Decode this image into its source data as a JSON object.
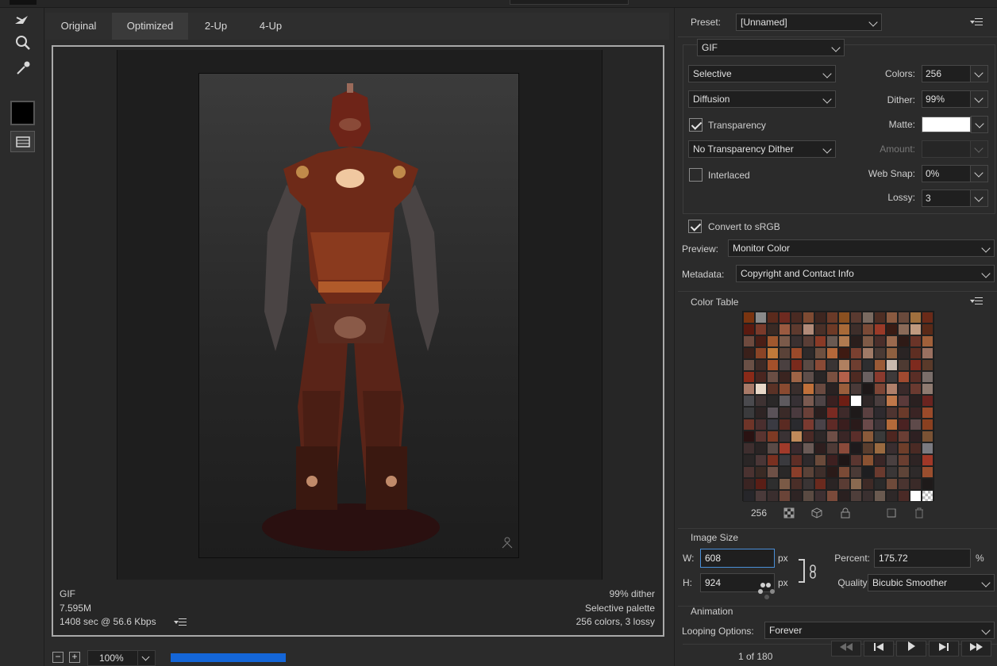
{
  "tabs": [
    {
      "label": "Original"
    },
    {
      "label": "Optimized"
    },
    {
      "label": "2-Up"
    },
    {
      "label": "4-Up"
    }
  ],
  "active_tab": "Optimized",
  "preview_info": {
    "format": "GIF",
    "size": "7.595M",
    "time": "1408 sec @ 56.6 Kbps",
    "dither": "99% dither",
    "palette": "Selective palette",
    "colors_lossy": "256 colors, 3 lossy"
  },
  "zoom": {
    "minus": "−",
    "plus": "+",
    "value": "100%"
  },
  "settings": {
    "preset_label": "Preset:",
    "preset_value": "[Unnamed]",
    "format_value": "GIF",
    "reduction_value": "Selective",
    "dither_algo_value": "Diffusion",
    "transparency_label": "Transparency",
    "transparency_checked": true,
    "transparency_dither_value": "No Transparency Dither",
    "interlaced_label": "Interlaced",
    "interlaced_checked": false,
    "colors_label": "Colors:",
    "colors_value": "256",
    "dither_label": "Dither:",
    "dither_value": "99%",
    "matte_label": "Matte:",
    "matte_color": "#ffffff",
    "amount_label": "Amount:",
    "amount_value": "",
    "websnap_label": "Web Snap:",
    "websnap_value": "0%",
    "lossy_label": "Lossy:",
    "lossy_value": "3",
    "convert_srgb_label": "Convert to sRGB",
    "convert_srgb_checked": true,
    "preview_label": "Preview:",
    "preview_value": "Monitor Color",
    "metadata_label": "Metadata:",
    "metadata_value": "Copyright and Contact Info"
  },
  "color_table": {
    "title": "Color Table",
    "count": "256",
    "colors": [
      "#7a3410",
      "#8a8a8a",
      "#5a2a1c",
      "#6e2a20",
      "#4a2a22",
      "#7e4a32",
      "#3e2620",
      "#6a3a28",
      "#8a5020",
      "#5a3a30",
      "#7a6a60",
      "#4e2e24",
      "#8a5a40",
      "#6a4a3c",
      "#a0703e",
      "#6a2a18",
      "#5a1a10",
      "#7a3a2a",
      "#3a2a24",
      "#9a5a40",
      "#5e3a2e",
      "#b08a78",
      "#4a3028",
      "#6e3a26",
      "#a86a38",
      "#3e2e2a",
      "#7a4a36",
      "#9a3a28",
      "#3a1c14",
      "#8a6a58",
      "#c09a80",
      "#5a2a18",
      "#6e4a3e",
      "#4a1e16",
      "#a0582e",
      "#7a5a4a",
      "#3a3030",
      "#5a3e36",
      "#8a3a26",
      "#6a5a52",
      "#b07a50",
      "#2a1e1c",
      "#7e5a46",
      "#4a2e2a",
      "#9a6a4e",
      "#2e1a16",
      "#6a3428",
      "#a0603a",
      "#3a201a",
      "#8a4426",
      "#c07a3a",
      "#5a4238",
      "#9a4a2a",
      "#2e2a2a",
      "#6e5040",
      "#b4683a",
      "#3e1a12",
      "#7a4030",
      "#a07a66",
      "#4a3a34",
      "#8e6040",
      "#2a2424",
      "#5e2e22",
      "#9a7060",
      "#6a5046",
      "#3e2a26",
      "#a4502a",
      "#4a4040",
      "#7a2a1c",
      "#5a4a44",
      "#8a4a36",
      "#3a3434",
      "#b08060",
      "#6e3e30",
      "#2e2e30",
      "#9a5a36",
      "#cabaae",
      "#4e3a32",
      "#7e2a1e",
      "#5a3a2a",
      "#8a2a18",
      "#4a2620",
      "#6a4e44",
      "#3a2420",
      "#9e6446",
      "#5e4e4a",
      "#2a2626",
      "#7a5040",
      "#b4604a",
      "#4e2a22",
      "#6a6060",
      "#8a3a2e",
      "#3e3a3a",
      "#a04a30",
      "#5a2e26",
      "#7a6e6a",
      "#a87a68",
      "#e8d8c8",
      "#5a3226",
      "#8a4a30",
      "#3a2e2c",
      "#c0703a",
      "#6a4a40",
      "#2a2222",
      "#9a5e3c",
      "#4a3a38",
      "#1e1818",
      "#7e4636",
      "#b0806a",
      "#3a2a2a",
      "#6a3a30",
      "#8e7a70",
      "#4a4a4e",
      "#3e3232",
      "#2a2828",
      "#5e5a5e",
      "#363034",
      "#7a5a50",
      "#4e4446",
      "#3a2020",
      "#6e1e14",
      "#ffffff",
      "#2e2626",
      "#4a3e3e",
      "#c0784a",
      "#5a3a3a",
      "#2a2020",
      "#6a2420",
      "#3a3a3c",
      "#2e2424",
      "#5a5258",
      "#3a2a28",
      "#4a3a3e",
      "#6a4038",
      "#2a1e1e",
      "#7a2a22",
      "#3e2a2a",
      "#1e1a1a",
      "#5a4040",
      "#2e2a2e",
      "#4e3430",
      "#6a3a2a",
      "#3a2424",
      "#9a4a2a",
      "#6e3428",
      "#4a2e2e",
      "#3a3a42",
      "#5a2a22",
      "#2a2a2e",
      "#7a3a30",
      "#4a4248",
      "#5e2a26",
      "#3a1e1e",
      "#2a1a1a",
      "#6a4a4a",
      "#3e3438",
      "#b46a3a",
      "#4a2222",
      "#5e4a4a",
      "#8a4020",
      "#2a1212",
      "#5a3430",
      "#7e3a24",
      "#3a3234",
      "#c08a5a",
      "#4a2a26",
      "#2e2828",
      "#6e4e46",
      "#3a2626",
      "#5a2e2a",
      "#8a5a3a",
      "#3a3a3a",
      "#4e2620",
      "#6a3e34",
      "#2e2022",
      "#7a5234",
      "#3e2e2e",
      "#2a2424",
      "#5a4a46",
      "#a03a2a",
      "#3a2a2e",
      "#6a5a56",
      "#2e1e1e",
      "#4e3a36",
      "#8a4a3a",
      "#1e1a1c",
      "#5a3e2e",
      "#9a6a40",
      "#3a2e30",
      "#6e3e2a",
      "#4a2a24",
      "#7a7a80",
      "#2a2626",
      "#4a3636",
      "#7a3020",
      "#3a3a3e",
      "#5e2e26",
      "#2e2a2c",
      "#6a4a3a",
      "#3e2020",
      "#1e1616",
      "#5a3630",
      "#8a5232",
      "#3a2626",
      "#4a4040",
      "#6a3e30",
      "#2e2424",
      "#a03828",
      "#4a3230",
      "#3a2a24",
      "#6e5046",
      "#2a2828",
      "#8a3e2a",
      "#5a4238",
      "#3e2e2a",
      "#2a1a18",
      "#7a4a36",
      "#4a3a36",
      "#1e1e20",
      "#6a3a2e",
      "#3a3636",
      "#5e4438",
      "#2e2a2a",
      "#9a4e2e",
      "#3a2422",
      "#5a1e16",
      "#2e2e2e",
      "#7a5a46",
      "#4a2e28",
      "#3a3434",
      "#6a2a1e",
      "#2a2424",
      "#5a3c34",
      "#8a6a50",
      "#3e2a26",
      "#2a2a2a",
      "#6e4a3a",
      "#4a3430",
      "#3a2a28",
      "#1e1a1a",
      "#26262a",
      "#4a3a3a",
      "#3a2e2e",
      "#6a4438",
      "#2e2424",
      "#5a4a42",
      "#3e3032",
      "#7a4a3a",
      "#2a2020",
      "#4e3e3a",
      "#3a3030",
      "#6a5a50",
      "#2e2828",
      "#4a2a26",
      "#ffffff",
      "#d8d8d8"
    ]
  },
  "image_size": {
    "title": "Image Size",
    "w_label": "W:",
    "w_value": "608",
    "h_label": "H:",
    "h_value": "924",
    "unit": "px",
    "percent_label": "Percent:",
    "percent_value": "175.72",
    "percent_unit": "%",
    "quality_label": "Quality:",
    "quality_value": "Bicubic Smoother"
  },
  "animation": {
    "title": "Animation",
    "looping_label": "Looping Options:",
    "looping_value": "Forever",
    "frame_counter": "1 of 180"
  }
}
